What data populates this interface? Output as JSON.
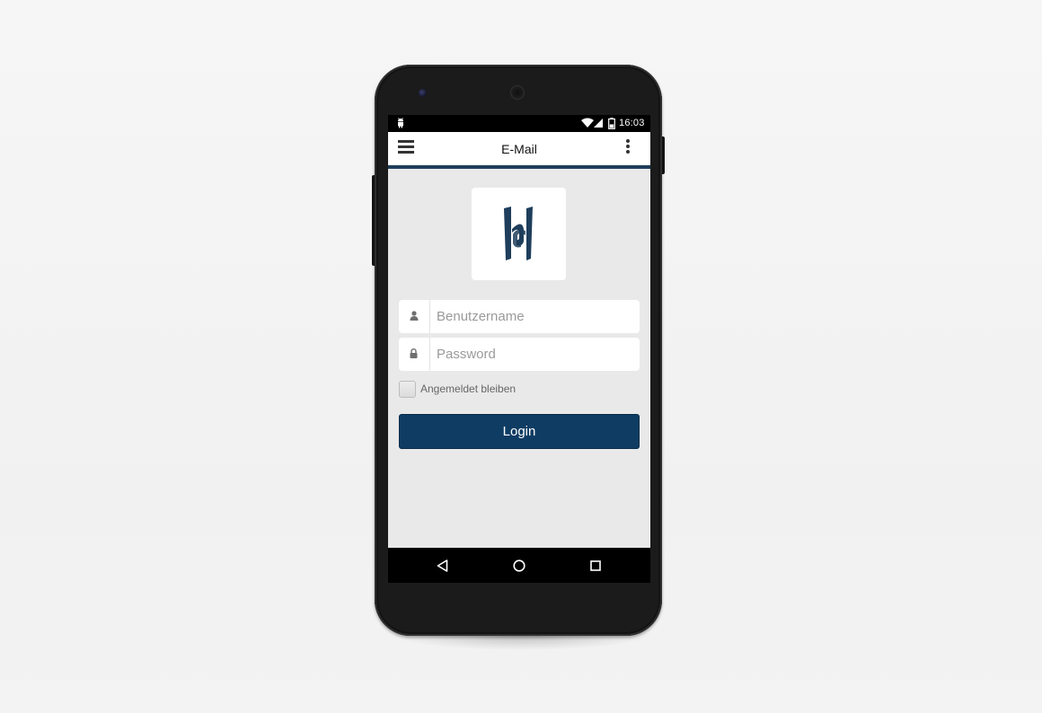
{
  "statusbar": {
    "time": "16:03",
    "icons": [
      "android-debug-icon",
      "wifi-icon",
      "signal-icon",
      "battery-icon"
    ]
  },
  "appbar": {
    "title": "E-Mail",
    "left_icon": "hamburger-menu-icon",
    "right_icon": "overflow-menu-icon"
  },
  "login": {
    "username_placeholder": "Benutzername",
    "username_icon": "user-icon",
    "password_placeholder": "Password",
    "password_icon": "lock-icon",
    "remember_label": "Angemeldet bleiben",
    "remember_checked": false,
    "button_label": "Login"
  },
  "navbar": {
    "icons": [
      "back-icon",
      "home-icon",
      "recents-icon"
    ]
  },
  "colors": {
    "primary": "#0f3c63",
    "appbar_underline": "#1f3e5c",
    "screen_background": "#e9e9e9"
  }
}
